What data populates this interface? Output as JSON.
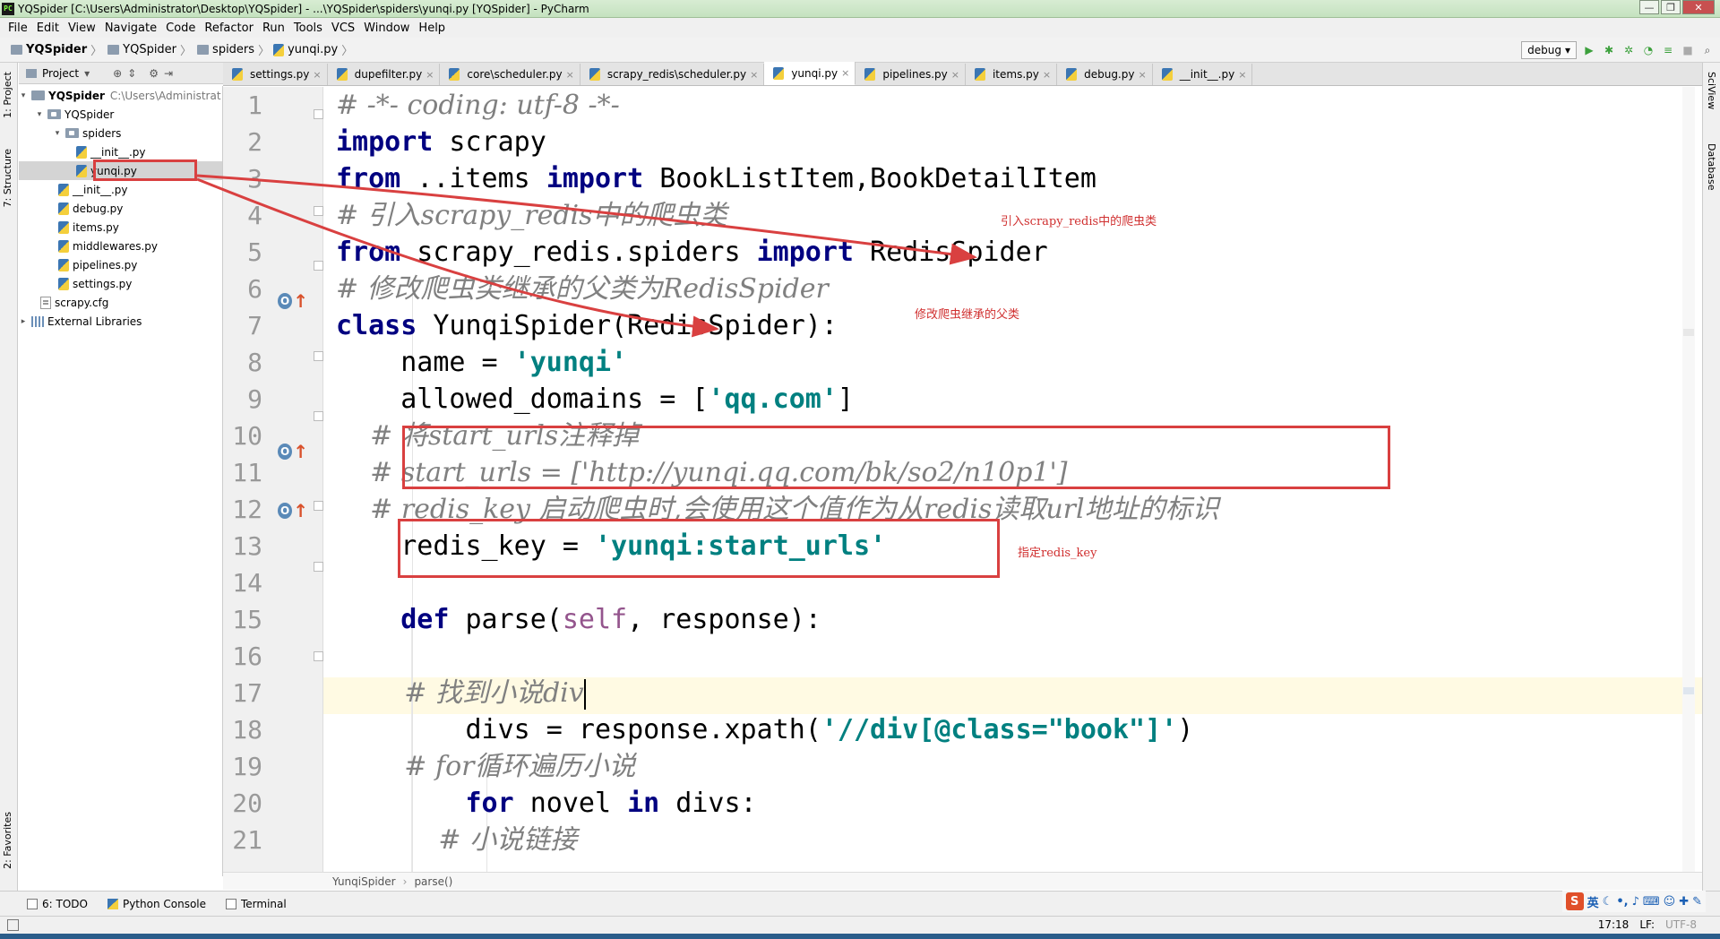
{
  "window": {
    "title": "YQSpider [C:\\Users\\Administrator\\Desktop\\YQSpider] - ...\\YQSpider\\spiders\\yunqi.py [YQSpider] - PyCharm",
    "controls": [
      "—",
      "❐",
      "✕"
    ]
  },
  "menu": [
    "File",
    "Edit",
    "View",
    "Navigate",
    "Code",
    "Refactor",
    "Run",
    "Tools",
    "VCS",
    "Window",
    "Help"
  ],
  "breadcrumb": [
    "YQSpider",
    "YQSpider",
    "spiders",
    "yunqi.py"
  ],
  "run": {
    "config": "debug"
  },
  "tool_strips": {
    "left": [
      "1: Project",
      "7: Structure",
      "2: Favorites"
    ],
    "right": [
      "SciView",
      "Database"
    ]
  },
  "project": {
    "header": "Project",
    "tree": [
      {
        "label": "YQSpider",
        "hint": "C:\\Users\\Administrat",
        "type": "folder",
        "arrow": "▾"
      },
      {
        "label": "YQSpider",
        "type": "folder",
        "arrow": "▾"
      },
      {
        "label": "spiders",
        "type": "folder",
        "arrow": "▾"
      },
      {
        "label": "__init__.py",
        "type": "py"
      },
      {
        "label": "yunqi.py",
        "type": "py"
      },
      {
        "label": "__init__.py",
        "type": "py"
      },
      {
        "label": "debug.py",
        "type": "py"
      },
      {
        "label": "items.py",
        "type": "py"
      },
      {
        "label": "middlewares.py",
        "type": "py"
      },
      {
        "label": "pipelines.py",
        "type": "py"
      },
      {
        "label": "settings.py",
        "type": "py"
      },
      {
        "label": "scrapy.cfg",
        "type": "cfg"
      },
      {
        "label": "External Libraries",
        "type": "lib",
        "arrow": "▸"
      }
    ]
  },
  "tabs": [
    "settings.py",
    "dupefilter.py",
    "core\\scheduler.py",
    "scrapy_redis\\scheduler.py",
    "yunqi.py",
    "pipelines.py",
    "items.py",
    "debug.py",
    "__init__.py"
  ],
  "active_tab": "yunqi.py",
  "line_numbers": [
    "1",
    "2",
    "3",
    "4",
    "5",
    "6",
    "7",
    "8",
    "9",
    "10",
    "11",
    "12",
    "13",
    "14",
    "15",
    "16",
    "17",
    "18",
    "19",
    "20",
    "21"
  ],
  "code": [
    {
      "parts": [
        {
          "c": "cm",
          "t": "# -*- coding: utf-8 -*-"
        }
      ]
    },
    {
      "parts": [
        {
          "c": "kw",
          "t": "import"
        },
        {
          "c": "",
          "t": " scrapy"
        }
      ]
    },
    {
      "parts": [
        {
          "c": "kw",
          "t": "from"
        },
        {
          "c": "",
          "t": " ..items "
        },
        {
          "c": "kw",
          "t": "import"
        },
        {
          "c": "",
          "t": " BookListItem,BookDetailItem"
        }
      ]
    },
    {
      "parts": [
        {
          "c": "cm",
          "t": "# 引入scrapy_redis中的爬虫类"
        }
      ]
    },
    {
      "parts": [
        {
          "c": "kw",
          "t": "from"
        },
        {
          "c": "",
          "t": " scrapy_redis.spiders "
        },
        {
          "c": "kw",
          "t": "import"
        },
        {
          "c": "",
          "t": " RedisSpider"
        }
      ]
    },
    {
      "parts": [
        {
          "c": "cm",
          "t": "# 修改爬虫类继承的父类为RedisSpider"
        }
      ]
    },
    {
      "parts": [
        {
          "c": "kw",
          "t": "class"
        },
        {
          "c": "",
          "t": " YunqiSpider(RedisSpider):"
        }
      ]
    },
    {
      "parts": [
        {
          "c": "",
          "t": "    name = "
        },
        {
          "c": "st",
          "t": "'yunqi'"
        }
      ]
    },
    {
      "parts": [
        {
          "c": "",
          "t": "    allowed_domains = ["
        },
        {
          "c": "st",
          "t": "'qq.com'"
        },
        {
          "c": "",
          "t": "]"
        }
      ]
    },
    {
      "parts": [
        {
          "c": "cm",
          "t": "    # 将start_urls注释掉"
        }
      ]
    },
    {
      "parts": [
        {
          "c": "cm",
          "t": "    # start_urls = ['http://yunqi.qq.com/bk/so2/n10p1']"
        }
      ]
    },
    {
      "parts": [
        {
          "c": "cm",
          "t": "    # redis_key 启动爬虫时,会使用这个值作为从redis读取url地址的标识"
        }
      ]
    },
    {
      "parts": [
        {
          "c": "",
          "t": "    redis_key = "
        },
        {
          "c": "st",
          "t": "'yunqi:start_urls'"
        }
      ]
    },
    {
      "parts": []
    },
    {
      "parts": [
        {
          "c": "",
          "t": "    "
        },
        {
          "c": "kw",
          "t": "def"
        },
        {
          "c": "",
          "t": " parse("
        },
        {
          "c": "sf",
          "t": "self"
        },
        {
          "c": "",
          "t": ", response):"
        }
      ]
    },
    {
      "parts": []
    },
    {
      "parts": [
        {
          "c": "cm",
          "t": "        # 找到小说div"
        }
      ],
      "caret": true
    },
    {
      "parts": [
        {
          "c": "",
          "t": "        divs = response.xpath("
        },
        {
          "c": "st",
          "t": "'//div[@class=\"book\"]'"
        },
        {
          "c": "",
          "t": ")"
        }
      ]
    },
    {
      "parts": [
        {
          "c": "cm",
          "t": "        # for循环遍历小说"
        }
      ]
    },
    {
      "parts": [
        {
          "c": "",
          "t": "        "
        },
        {
          "c": "kw",
          "t": "for"
        },
        {
          "c": "",
          "t": " novel "
        },
        {
          "c": "kw",
          "t": "in"
        },
        {
          "c": "",
          "t": " divs:"
        }
      ]
    },
    {
      "parts": [
        {
          "c": "cm",
          "t": "            # 小说链接"
        }
      ]
    }
  ],
  "annotations": {
    "import_redis": "引入scrapy_redis中的爬虫类",
    "parent_class": "修改爬虫继承的父类",
    "redis_key": "指定redis_key"
  },
  "editor_breadcrumb": [
    "YunqiSpider",
    "parse()"
  ],
  "bottom_tools": [
    "6: TODO",
    "Python Console",
    "Terminal"
  ],
  "status": {
    "position": "17:18",
    "line_sep": "LF:",
    "encoding": "UTF-8"
  },
  "ime": {
    "logo": "S",
    "lang": "英"
  }
}
